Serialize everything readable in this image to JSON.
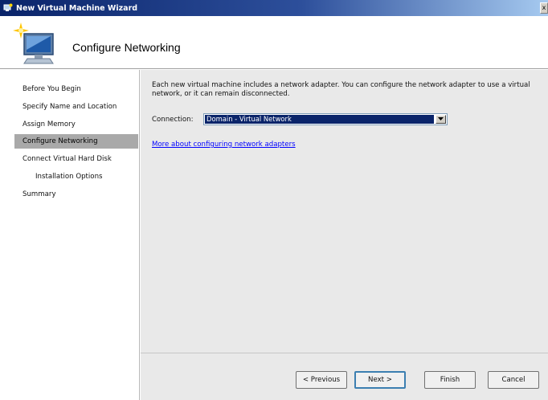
{
  "window": {
    "title": "New Virtual Machine Wizard",
    "close_glyph": "x"
  },
  "header": {
    "title": "Configure Networking",
    "icon": "computer-with-sparkle-icon"
  },
  "sidebar": {
    "items": [
      {
        "label": "Before You Begin",
        "active": false,
        "indent": false
      },
      {
        "label": "Specify Name and Location",
        "active": false,
        "indent": false
      },
      {
        "label": "Assign Memory",
        "active": false,
        "indent": false
      },
      {
        "label": "Configure Networking",
        "active": true,
        "indent": false
      },
      {
        "label": "Connect Virtual Hard Disk",
        "active": false,
        "indent": false
      },
      {
        "label": "Installation Options",
        "active": false,
        "indent": true
      },
      {
        "label": "Summary",
        "active": false,
        "indent": false
      }
    ]
  },
  "main": {
    "description": "Each new virtual machine includes a network adapter. You can configure the network adapter to use a virtual network, or it can remain disconnected.",
    "connection_label": "Connection:",
    "connection_value": "Domain - Virtual Network",
    "help_link": "More about configuring network adapters"
  },
  "footer": {
    "previous_label": "< Previous",
    "next_label": "Next >",
    "finish_label": "Finish",
    "cancel_label": "Cancel"
  },
  "colors": {
    "titlebar": "#0a246a",
    "selection": "#0a246a",
    "link": "#0000ff",
    "content_bg": "#e9e9e9",
    "active_nav": "#a9a9a9"
  }
}
